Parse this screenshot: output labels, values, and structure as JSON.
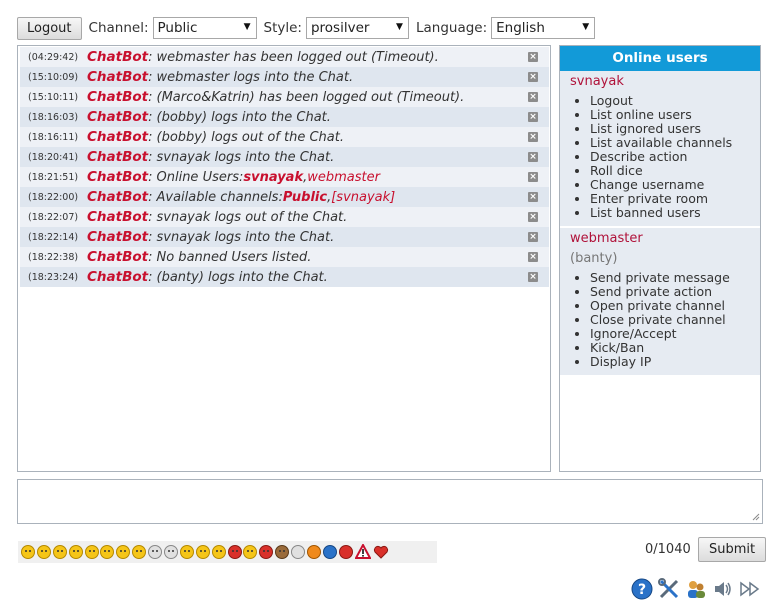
{
  "toolbar": {
    "logout_label": "Logout",
    "channel_label": "Channel:",
    "channel_value": "Public",
    "style_label": "Style:",
    "style_value": "prosilver",
    "language_label": "Language:",
    "language_value": "English"
  },
  "chat": {
    "messages": [
      {
        "time": "(04:29:42)",
        "user": "ChatBot",
        "text": "webmaster has been logged out (Timeout)."
      },
      {
        "time": "(15:10:09)",
        "user": "ChatBot",
        "text": "webmaster logs into the Chat."
      },
      {
        "time": "(15:10:11)",
        "user": "ChatBot",
        "text": "(Marco&Katrin) has been logged out (Timeout)."
      },
      {
        "time": "(18:16:03)",
        "user": "ChatBot",
        "text": "(bobby) logs into the Chat."
      },
      {
        "time": "(18:16:11)",
        "user": "ChatBot",
        "text": "(bobby) logs out of the Chat."
      },
      {
        "time": "(18:20:41)",
        "user": "ChatBot",
        "text": "svnayak logs into the Chat."
      },
      {
        "time": "(18:21:51)",
        "user": "ChatBot",
        "text": "Online Users: ",
        "parts": [
          "svnayak",
          ", ",
          "webmaster"
        ]
      },
      {
        "time": "(18:22:00)",
        "user": "ChatBot",
        "text": "Available channels: ",
        "parts": [
          "Public",
          ", ",
          "[svnayak]"
        ]
      },
      {
        "time": "(18:22:07)",
        "user": "ChatBot",
        "text": "svnayak logs out of the Chat."
      },
      {
        "time": "(18:22:14)",
        "user": "ChatBot",
        "text": "svnayak logs into the Chat."
      },
      {
        "time": "(18:22:38)",
        "user": "ChatBot",
        "text": "No banned Users listed."
      },
      {
        "time": "(18:23:24)",
        "user": "ChatBot",
        "text": "(banty) logs into the Chat."
      }
    ],
    "colon": ":",
    "delete_glyph": "×"
  },
  "online": {
    "title": "Online users",
    "users": [
      {
        "name": "svnayak",
        "actions": [
          "Logout",
          "List online users",
          "List ignored users",
          "List available channels",
          "Describe action",
          "Roll dice",
          "Change username",
          "Enter private room",
          "List banned users"
        ]
      },
      {
        "name": "webmaster",
        "subname": "(banty)",
        "actions": [
          "Send private message",
          "Send private action",
          "Open private channel",
          "Close private channel",
          "Ignore/Accept",
          "Kick/Ban",
          "Display IP"
        ]
      }
    ]
  },
  "input": {
    "counter": "0/1040",
    "submit_label": "Submit"
  },
  "emoticons": [
    "smile",
    "sad",
    "sad",
    "tongue",
    "wink",
    "neutral",
    "surprised",
    "grin",
    "nerd",
    "glasses",
    "cool",
    "laugh",
    "cry",
    "tongue-out",
    "grin",
    "devil",
    "monkey",
    "lightbulb",
    "exclamation",
    "question",
    "no-entry",
    "warning",
    "heart"
  ],
  "colors": {
    "accent": "#129ad8",
    "chatbot": "#c8102e",
    "username": "#b0123a"
  },
  "bottom_icons": [
    "help-icon",
    "settings-icon",
    "users-icon",
    "sound-icon",
    "fast-forward-icon"
  ]
}
